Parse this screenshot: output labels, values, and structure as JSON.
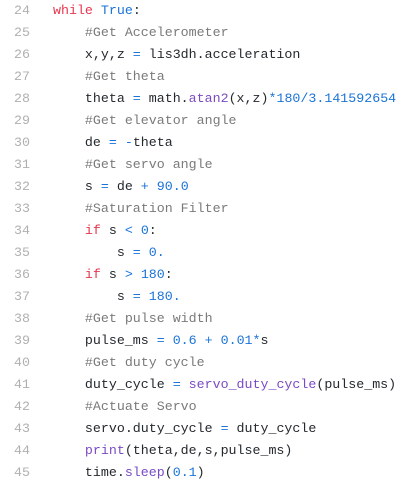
{
  "lines": [
    {
      "n": "24",
      "t": [
        [
          "while",
          "k"
        ],
        [
          " ",
          ""
        ],
        [
          "True",
          "b"
        ],
        [
          ":",
          ""
        ]
      ]
    },
    {
      "n": "25",
      "t": [
        [
          "    ",
          ""
        ],
        [
          "#Get Accelerometer",
          "c"
        ]
      ]
    },
    {
      "n": "26",
      "t": [
        [
          "    x,y,z ",
          ""
        ],
        [
          "=",
          "o"
        ],
        [
          " lis3dh.acceleration",
          ""
        ]
      ]
    },
    {
      "n": "27",
      "t": [
        [
          "    ",
          ""
        ],
        [
          "#Get theta",
          "c"
        ]
      ]
    },
    {
      "n": "28",
      "t": [
        [
          "    theta ",
          ""
        ],
        [
          "=",
          "o"
        ],
        [
          " math.",
          ""
        ],
        [
          "atan2",
          "f"
        ],
        [
          "(x,z)",
          ""
        ],
        [
          "*180/3.141592654",
          "n"
        ]
      ]
    },
    {
      "n": "29",
      "t": [
        [
          "    ",
          ""
        ],
        [
          "#Get elevator angle",
          "c"
        ]
      ]
    },
    {
      "n": "30",
      "t": [
        [
          "    de ",
          ""
        ],
        [
          "=",
          "o"
        ],
        [
          " ",
          ""
        ],
        [
          "-",
          "o"
        ],
        [
          "theta",
          ""
        ]
      ]
    },
    {
      "n": "31",
      "t": [
        [
          "    ",
          ""
        ],
        [
          "#Get servo angle",
          "c"
        ]
      ]
    },
    {
      "n": "32",
      "t": [
        [
          "    s ",
          ""
        ],
        [
          "=",
          "o"
        ],
        [
          " de ",
          ""
        ],
        [
          "+",
          "o"
        ],
        [
          " ",
          ""
        ],
        [
          "90.0",
          "n"
        ]
      ]
    },
    {
      "n": "33",
      "t": [
        [
          "    ",
          ""
        ],
        [
          "#Saturation Filter",
          "c"
        ]
      ]
    },
    {
      "n": "34",
      "t": [
        [
          "    ",
          ""
        ],
        [
          "if",
          "k"
        ],
        [
          " s ",
          ""
        ],
        [
          "<",
          "o"
        ],
        [
          " ",
          ""
        ],
        [
          "0",
          "n"
        ],
        [
          ":",
          ""
        ]
      ]
    },
    {
      "n": "35",
      "t": [
        [
          "        s ",
          ""
        ],
        [
          "=",
          "o"
        ],
        [
          " ",
          ""
        ],
        [
          "0.",
          "n"
        ]
      ]
    },
    {
      "n": "36",
      "t": [
        [
          "    ",
          ""
        ],
        [
          "if",
          "k"
        ],
        [
          " s ",
          ""
        ],
        [
          ">",
          "o"
        ],
        [
          " ",
          ""
        ],
        [
          "180",
          "n"
        ],
        [
          ":",
          ""
        ]
      ]
    },
    {
      "n": "37",
      "t": [
        [
          "        s ",
          ""
        ],
        [
          "=",
          "o"
        ],
        [
          " ",
          ""
        ],
        [
          "180.",
          "n"
        ]
      ]
    },
    {
      "n": "38",
      "t": [
        [
          "    ",
          ""
        ],
        [
          "#Get pulse width",
          "c"
        ]
      ]
    },
    {
      "n": "39",
      "t": [
        [
          "    pulse_ms ",
          ""
        ],
        [
          "=",
          "o"
        ],
        [
          " ",
          ""
        ],
        [
          "0.6",
          "n"
        ],
        [
          " ",
          ""
        ],
        [
          "+",
          "o"
        ],
        [
          " ",
          ""
        ],
        [
          "0.01",
          "n"
        ],
        [
          "*",
          "o"
        ],
        [
          "s",
          ""
        ]
      ]
    },
    {
      "n": "40",
      "t": [
        [
          "    ",
          ""
        ],
        [
          "#Get duty cycle",
          "c"
        ]
      ]
    },
    {
      "n": "41",
      "t": [
        [
          "    duty_cycle ",
          ""
        ],
        [
          "=",
          "o"
        ],
        [
          " ",
          ""
        ],
        [
          "servo_duty_cycle",
          "f"
        ],
        [
          "(pulse_ms)",
          ""
        ]
      ]
    },
    {
      "n": "42",
      "t": [
        [
          "    ",
          ""
        ],
        [
          "#Actuate Servo",
          "c"
        ]
      ]
    },
    {
      "n": "43",
      "t": [
        [
          "    servo.duty_cycle ",
          ""
        ],
        [
          "=",
          "o"
        ],
        [
          " duty_cycle",
          ""
        ]
      ]
    },
    {
      "n": "44",
      "t": [
        [
          "    ",
          ""
        ],
        [
          "print",
          "f"
        ],
        [
          "(theta,de,s,pulse_ms)",
          ""
        ]
      ]
    },
    {
      "n": "45",
      "t": [
        [
          "    time.",
          ""
        ],
        [
          "sleep",
          "f"
        ],
        [
          "(",
          ""
        ],
        [
          "0.1",
          "n"
        ],
        [
          ")",
          ""
        ]
      ]
    }
  ]
}
